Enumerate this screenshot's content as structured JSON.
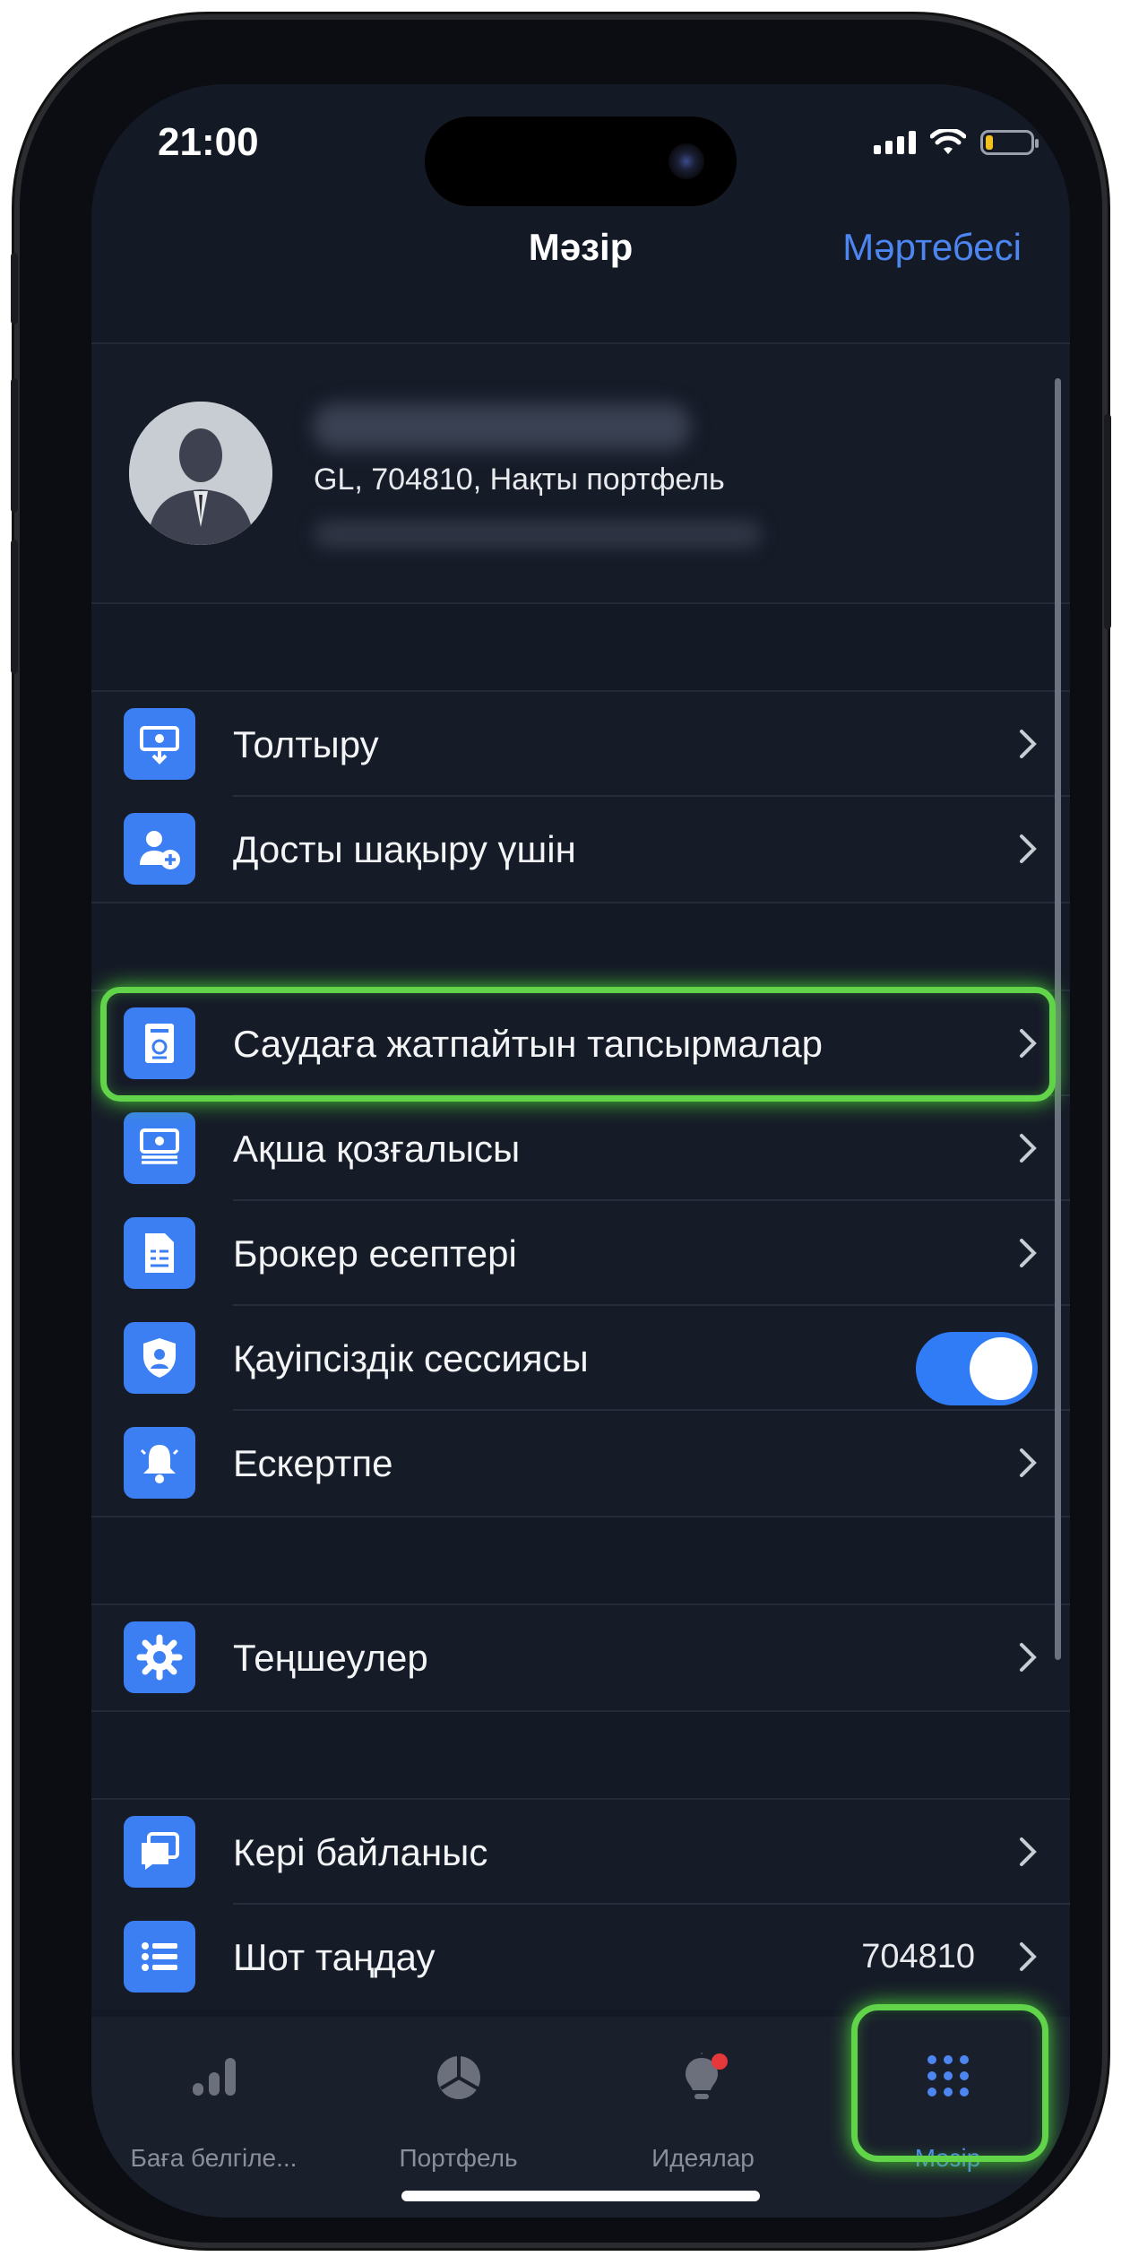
{
  "status_bar": {
    "time": "21:00"
  },
  "header": {
    "title": "Мәзір",
    "right_action": "Мәртебесі"
  },
  "profile": {
    "account_line": "GL, 704810, Нақты портфель"
  },
  "menu": {
    "group1": [
      {
        "label": "Толтыру",
        "icon": "deposit-icon"
      },
      {
        "label": "Досты шақыру үшін",
        "icon": "invite-friend-icon"
      }
    ],
    "group2": [
      {
        "label": "Саудаға жатпайтын тапсырмалар",
        "icon": "non-trade-orders-icon"
      },
      {
        "label": "Ақша қозғалысы",
        "icon": "money-movement-icon"
      },
      {
        "label": "Брокер есептері",
        "icon": "broker-reports-icon"
      },
      {
        "label": "Қауіпсіздік сессиясы",
        "icon": "security-shield-icon",
        "toggle_on": true
      },
      {
        "label": "Ескертпе",
        "icon": "bell-icon"
      }
    ],
    "group3": [
      {
        "label": "Теңшеулер",
        "icon": "gear-icon"
      }
    ],
    "group4": [
      {
        "label": "Кері байланыс",
        "icon": "feedback-icon"
      },
      {
        "label": "Шот таңдау",
        "icon": "list-icon",
        "value": "704810"
      }
    ]
  },
  "tabbar": [
    {
      "label": "Баға белгіле...",
      "icon": "bar-chart-icon",
      "active": false
    },
    {
      "label": "Портфель",
      "icon": "pie-chart-icon",
      "active": false
    },
    {
      "label": "Идеялар",
      "icon": "lightbulb-icon",
      "active": false
    },
    {
      "label": "Мәзір",
      "icon": "grid-menu-icon",
      "active": true
    }
  ],
  "colors": {
    "accent": "#3b7ff2",
    "highlight": "#62d44a",
    "background": "#141926"
  }
}
